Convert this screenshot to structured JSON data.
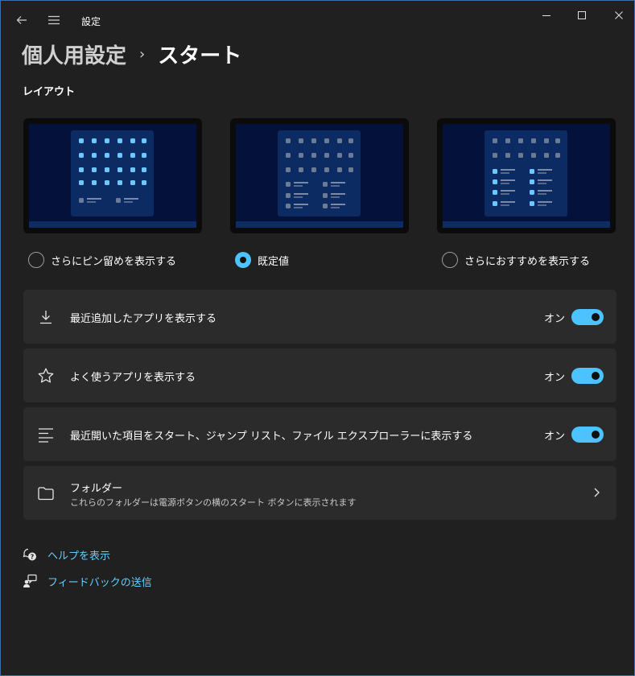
{
  "window": {
    "title": "設定"
  },
  "breadcrumb": {
    "parent": "個人用設定",
    "separator": "›",
    "current": "スタート"
  },
  "layout_section": {
    "title": "レイアウト"
  },
  "layout_options": [
    {
      "label": "さらにピン留めを表示する",
      "selected": false
    },
    {
      "label": "既定値",
      "selected": true
    },
    {
      "label": "さらにおすすめを表示する",
      "selected": false
    }
  ],
  "settings": [
    {
      "label": "最近追加したアプリを表示する",
      "state": "オン",
      "on": true,
      "icon": "download-icon"
    },
    {
      "label": "よく使うアプリを表示する",
      "state": "オン",
      "on": true,
      "icon": "star-icon"
    },
    {
      "label": "最近開いた項目をスタート、ジャンプ リスト、ファイル エクスプローラーに表示する",
      "state": "オン",
      "on": true,
      "icon": "list-icon"
    }
  ],
  "folders": {
    "title": "フォルダー",
    "subtitle": "これらのフォルダーは電源ボタンの横のスタート ボタンに表示されます",
    "icon": "folder-icon"
  },
  "links": [
    {
      "label": "ヘルプを表示",
      "icon": "help-icon"
    },
    {
      "label": "フィードバックの送信",
      "icon": "feedback-icon"
    }
  ],
  "colors": {
    "accent": "#4cc2ff",
    "background": "#202020",
    "card": "#2b2b2b",
    "link": "#60cdff"
  }
}
